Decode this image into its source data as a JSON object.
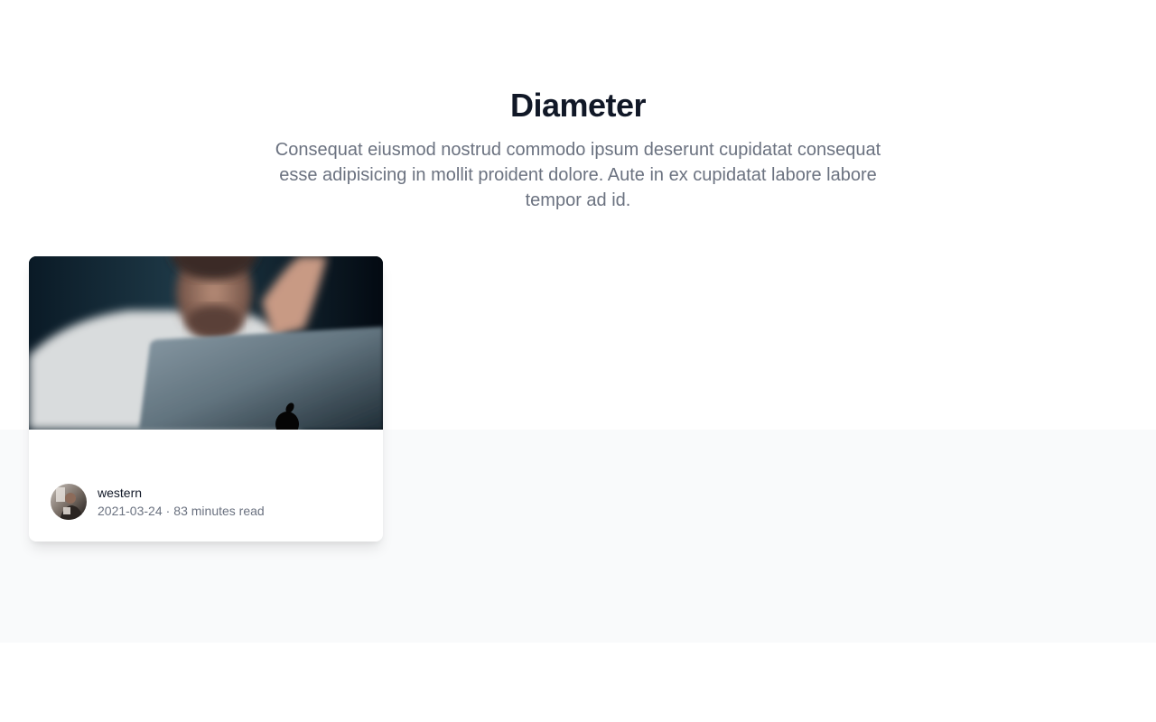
{
  "header": {
    "title": "Diameter",
    "subtitle": "Consequat eiusmod nostrud commodo ipsum deserunt cupidatat consequat esse adipisicing in mollit proident dolore. Aute in ex cupidatat labore labore tempor ad id."
  },
  "posts": [
    {
      "image": "photo-man-with-laptop",
      "author": {
        "name": "western",
        "avatar": "author-avatar-photo"
      },
      "date": "2021-03-24",
      "separator": "·",
      "read_time": "83 minutes read"
    }
  ],
  "colors": {
    "title": "#111827",
    "text_muted": "#6b7280",
    "band_background": "#f9fafb",
    "card_background": "#ffffff"
  }
}
